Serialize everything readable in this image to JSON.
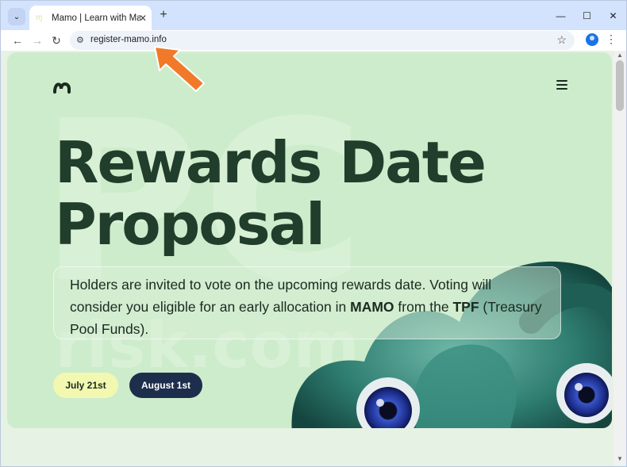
{
  "browser": {
    "tab_title": "Mamo | Learn with Mamo, Earn",
    "url": "register-mamo.info",
    "tab_close": "✕",
    "new_tab": "+",
    "minimize": "—",
    "maximize": "☐",
    "close": "✕"
  },
  "hero": {
    "title_line1": "Rewards Date",
    "title_line2": "Proposal",
    "desc_part1": "Holders are invited to vote on the upcoming rewards date. Voting will consider you eligible for an early allocation in ",
    "desc_bold1": "MAMO",
    "desc_part2": " from the ",
    "desc_bold2": "TPF",
    "desc_part3": " (Treasury Pool Funds).",
    "button_july": "July 21st",
    "button_august": "August 1st"
  },
  "icons": {
    "back": "back-arrow-icon",
    "forward": "forward-arrow-icon",
    "reload": "reload-icon",
    "star": "bookmark-star-icon",
    "menu": "kebab-menu-icon"
  },
  "colors": {
    "page_bg": "#cdeccb",
    "title": "#213d2b",
    "button_july_bg": "#f2f8b0",
    "button_august_bg": "#1d2e4c",
    "annotation_arrow": "#f07a2a"
  }
}
